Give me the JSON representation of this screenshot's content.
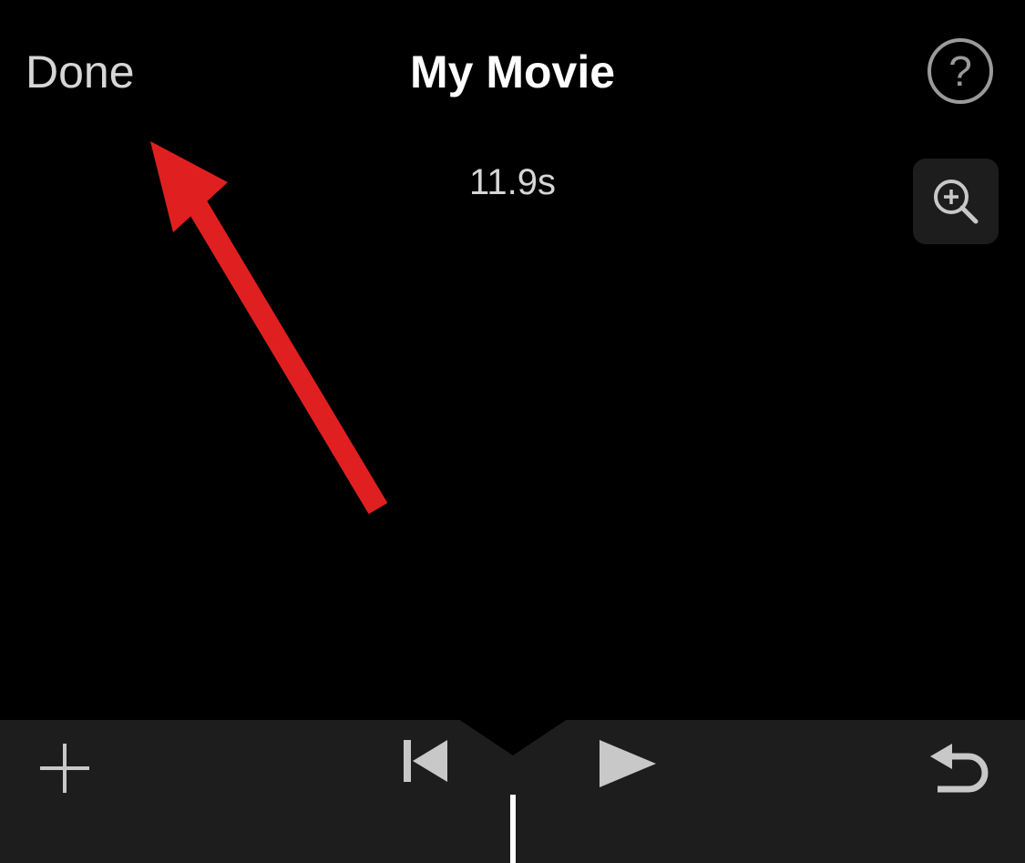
{
  "header": {
    "done_label": "Done",
    "title": "My Movie",
    "help_icon": "question-mark-icon",
    "help_label": "?"
  },
  "preview": {
    "duration": "11.9s",
    "zoom_icon": "zoom-in-icon"
  },
  "annotation": {
    "type": "arrow",
    "color": "#e02020"
  },
  "toolbar": {
    "add_icon": "plus-icon",
    "rewind_icon": "skip-to-start-icon",
    "play_icon": "play-icon",
    "undo_icon": "undo-icon"
  }
}
